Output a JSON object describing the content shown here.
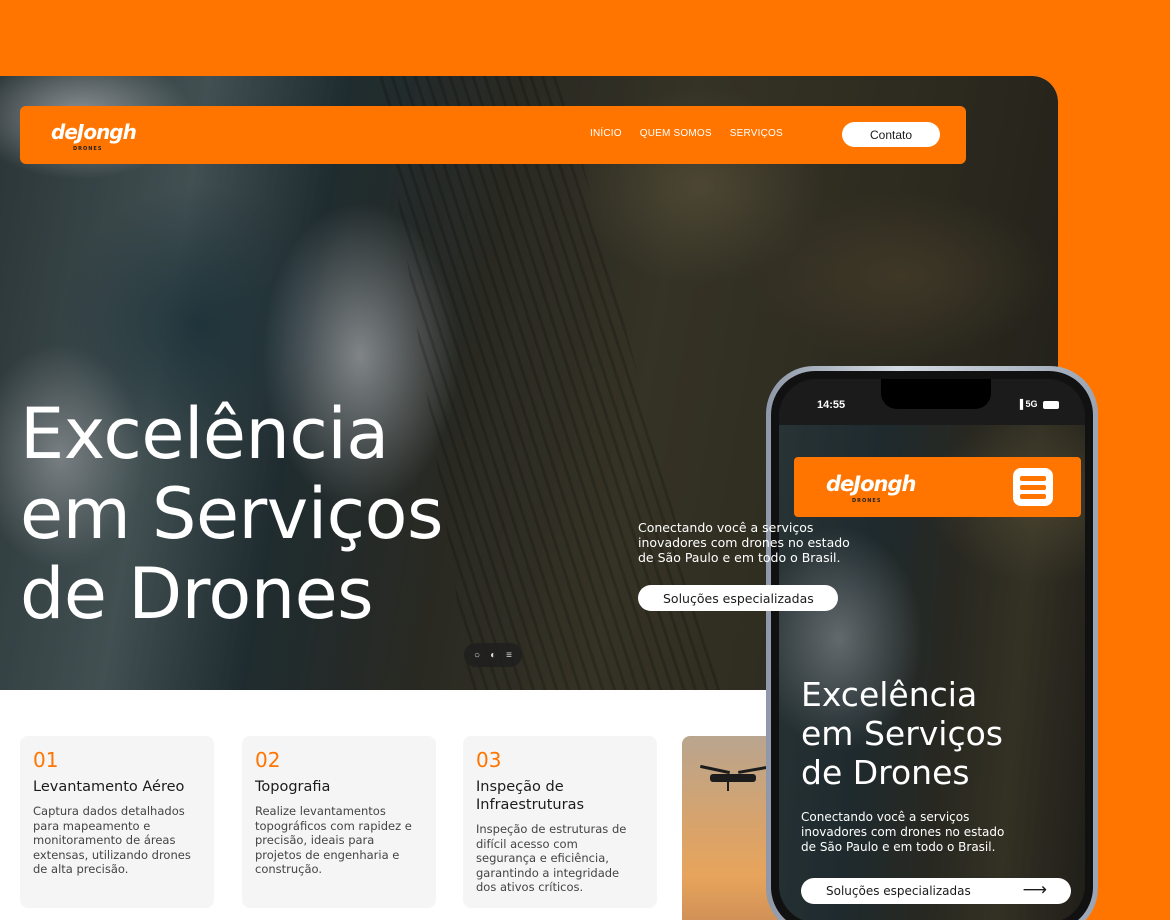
{
  "colors": {
    "brand": "#ff7500",
    "white": "#ffffff",
    "dark": "#1a1a1a"
  },
  "desktop": {
    "logo": {
      "text": "deJongh",
      "sub": "DRONES"
    },
    "nav": [
      "INÍCIO",
      "QUEM SOMOS",
      "SERVIÇOS"
    ],
    "contact_label": "Contato",
    "hero": {
      "title_lines": [
        "Excelência",
        "em Serviços",
        "de Drones"
      ],
      "subtitle_lines": [
        "Conectando você a serviços",
        "inovadores com drones no estado",
        "de São Paulo e em todo o Brasil."
      ],
      "cta_label": "Soluções especializadas"
    },
    "widget_icons": [
      "chat-icon",
      "toggle-icon",
      "sliders-icon"
    ],
    "cards": [
      {
        "number": "01",
        "title_lines": [
          "Levantamento Aéreo"
        ],
        "text_lines": [
          "Captura dados detalhados",
          "para mapeamento e",
          "monitoramento de áreas",
          "extensas, utilizando drones",
          "de alta precisão."
        ]
      },
      {
        "number": "02",
        "title_lines": [
          "Topografia"
        ],
        "text_lines": [
          "Realize levantamentos",
          "topográficos com rapidez e",
          "precisão, ideais para",
          "projetos de engenharia e",
          "construção."
        ]
      },
      {
        "number": "03",
        "title_lines": [
          "Inspeção de",
          "Infraestruturas"
        ],
        "text_lines": [
          "Inspeção de estruturas de",
          "difícil acesso com",
          "segurança e eficiência,",
          "garantindo a integridade",
          "dos ativos críticos."
        ]
      }
    ]
  },
  "phone": {
    "status": {
      "time": "14:55",
      "network": "5G"
    },
    "logo": {
      "text": "deJongh",
      "sub": "DRONES"
    },
    "title_lines": [
      "Excelência",
      "em Serviços",
      "de Drones"
    ],
    "subtitle_lines": [
      "Conectando você a serviços",
      "inovadores com drones no estado",
      "de São Paulo e em todo o Brasil."
    ],
    "cta_label": "Soluções especializadas",
    "cta_arrow": "⟶"
  }
}
